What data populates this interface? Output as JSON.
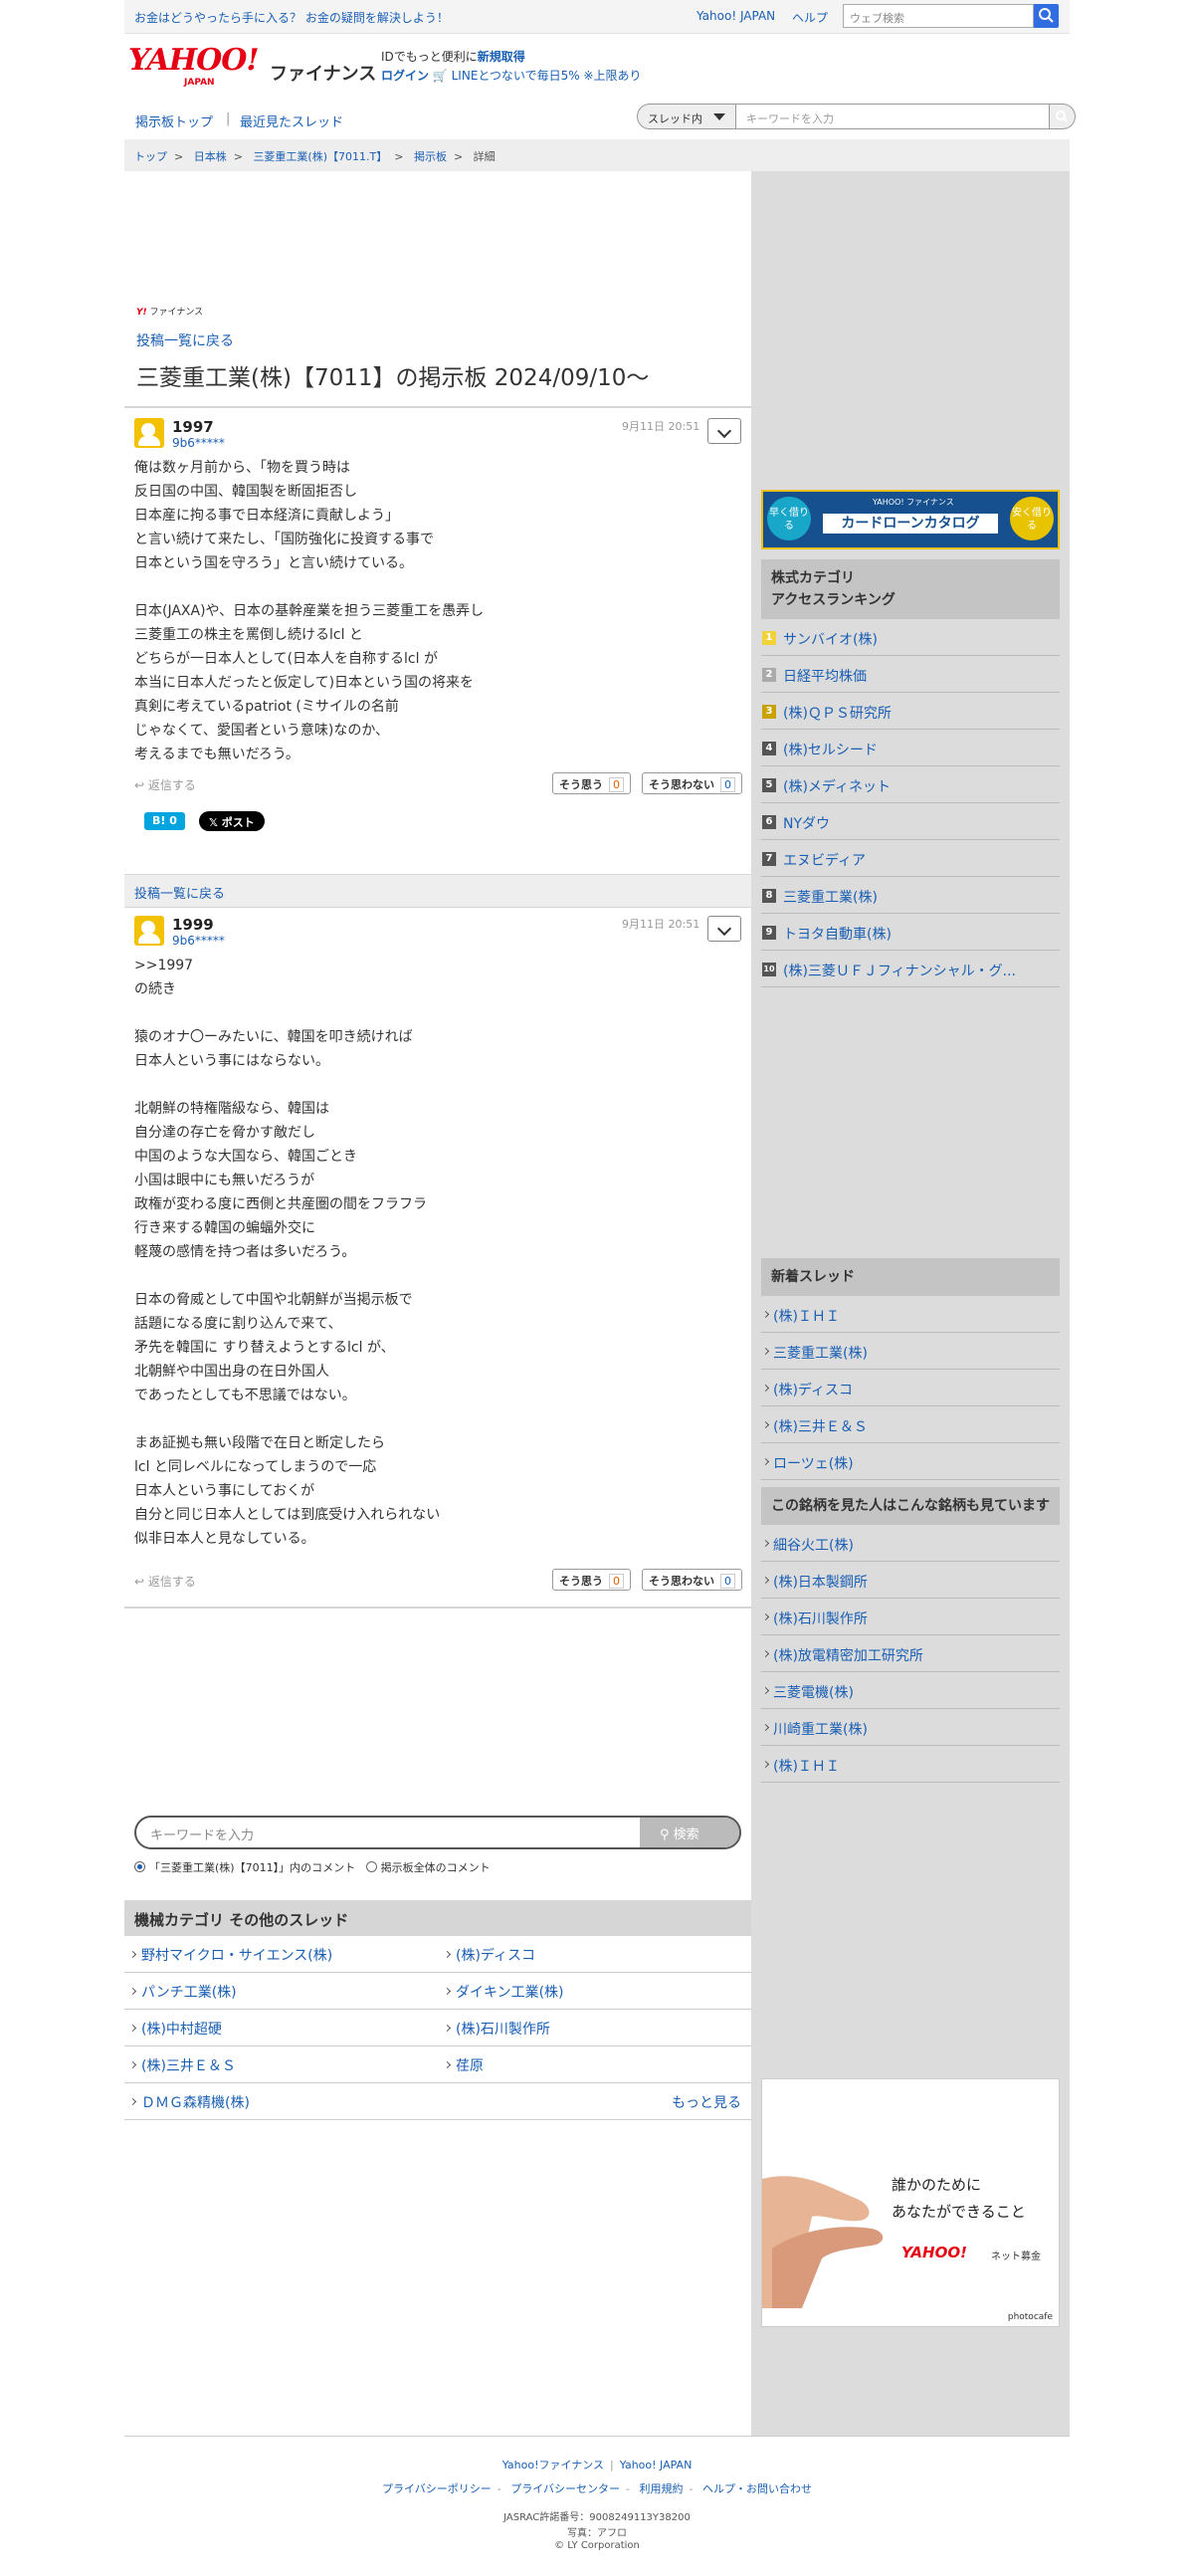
{
  "topbar": {
    "promo": "お金はどうやったら手に入る？ お金の疑問を解決しよう！",
    "yahoo_japan": "Yahoo! JAPAN",
    "help": "ヘルプ",
    "web_search_placeholder": "ウェブ検索"
  },
  "header": {
    "logo_main": "YAHOO!",
    "logo_sub": "JAPAN",
    "service": "ファイナンス",
    "line1_prefix": "IDでもっと便利に",
    "line1_link": "新規取得",
    "login": "ログイン",
    "line_promo": "LINEとつないで毎日5% ※上限あり"
  },
  "nav": {
    "board_top": "掲示板トップ",
    "recent": "最近見たスレッド",
    "scope": "スレッド内",
    "keyword_placeholder": "キーワードを入力"
  },
  "breadcrumb": [
    "トップ",
    "日本株",
    "三菱重工業(株)【7011.T】",
    "掲示板",
    "詳細"
  ],
  "thread": {
    "logo_small": "ファイナンス",
    "back": "投稿一覧に戻る",
    "title": "三菱重工業(株)【7011】の掲示板 2024/09/10〜"
  },
  "posts": [
    {
      "number": "1997",
      "user": "9b6*****",
      "date": "9月11日 20:51",
      "body": "俺は数ヶ月前から、「物を買う時は\n反日国の中国、韓国製を断固拒否し\n日本産に拘る事で日本経済に貢献しよう」\nと言い続けて来たし、「国防強化に投資する事で\n日本という国を守ろう」と言い続けている。\n\n日本(JAXA)や、日本の基幹産業を担う三菱重工を愚弄し\n三菱重工の株主を罵倒し続けるlcl と\nどちらが一日本人として(日本人を自称するlcl が\n本当に日本人だったと仮定して)日本という国の将来を\n真剣に考えているpatriot (ミサイルの名前\nじゃなくて、愛国者という意味)なのか、\n考えるまでも無いだろう。",
      "reply": "返信する",
      "agree_label": "そう思う",
      "agree": "0",
      "disagree_label": "そう思わない",
      "disagree": "0"
    },
    {
      "number": "1999",
      "user": "9b6*****",
      "date": "9月11日 20:51",
      "body": ">>1997\nの続き\n\n猿のオナ〇ーみたいに、韓国を叩き続ければ\n日本人という事にはならない。\n\n北朝鮮の特権階級なら、韓国は\n自分達の存亡を脅かす敵だし\n中国のような大国なら、韓国ごとき\n小国は眼中にも無いだろうが\n政権が変わる度に西側と共産圏の間をフラフラ\n行き来する韓国の蝙蝠外交に\n軽蔑の感情を持つ者は多いだろう。\n\n日本の脅威として中国や北朝鮮が当掲示板で\n話題になる度に割り込んで来て、\n矛先を韓国に すり替えようとするlcl が、\n北朝鮮や中国出身の在日外国人\nであったとしても不思議ではない。\n\nまあ証拠も無い段階で在日と断定したら\nlcl と同レベルになってしまうので一応\n日本人という事にしておくが\n自分と同じ日本人としては到底受け入れられない\n似非日本人と見なしている。",
      "reply": "返信する",
      "agree_label": "そう思う",
      "agree": "0",
      "disagree_label": "そう思わない",
      "disagree": "0"
    }
  ],
  "share": {
    "hatena": "B! 0",
    "x_post": "𝕏 ポスト"
  },
  "back_bar": "投稿一覧に戻る",
  "bottom_search": {
    "placeholder": "キーワードを入力",
    "button": "検索",
    "radio1": "「三菱重工業(株)【7011】」内のコメント",
    "radio2": "掲示板全体のコメント"
  },
  "other_threads": {
    "header": "機械カテゴリ  その他のスレッド",
    "rows": [
      [
        "野村マイクロ・サイエンス(株)",
        "(株)ディスコ"
      ],
      [
        "パンチ工業(株)",
        "ダイキン工業(株)"
      ],
      [
        "(株)中村超硬",
        "(株)石川製作所"
      ],
      [
        "(株)三井Ｅ＆Ｓ",
        "荏原"
      ]
    ],
    "last": "ＤＭＧ森精機(株)",
    "more": "もっと見る"
  },
  "ad_loan": {
    "left": "早く借りる",
    "right": "安く借りる",
    "brand": "YAHOO! ファイナンス",
    "main": "カードローンカタログ"
  },
  "ranking": {
    "header": "株式カテゴリ\nアクセスランキング",
    "items": [
      "サンバイオ(株)",
      "日経平均株価",
      "(株)ＱＰＳ研究所",
      "(株)セルシード",
      "(株)メディネット",
      "NYダウ",
      "エヌビディア",
      "三菱重工業(株)",
      "トヨタ自動車(株)",
      "(株)三菱ＵＦＪフィナンシャル・グ..."
    ]
  },
  "new_threads": {
    "header": "新着スレッド",
    "items": [
      "(株)ＩＨＩ",
      "三菱重工業(株)",
      "(株)ディスコ",
      "(株)三井Ｅ＆Ｓ",
      "ローツェ(株)"
    ]
  },
  "also_viewed": {
    "header": "この銘柄を見た人はこんな銘柄も見ています",
    "items": [
      "細谷火工(株)",
      "(株)日本製鋼所",
      "(株)石川製作所",
      "(株)放電精密加工研究所",
      "三菱電機(株)",
      "川崎重工業(株)",
      "(株)ＩＨＩ"
    ]
  },
  "ad_hand": {
    "line1": "誰かのために",
    "line2": "あなたができること",
    "brand": "YAHOO!",
    "brand_sub": "ネット募金",
    "photo": "photocafe"
  },
  "footer": {
    "link1": "Yahoo!ファイナンス",
    "link2": "Yahoo! JAPAN",
    "links": [
      "プライバシーポリシー",
      "プライバシーセンター",
      "利用規約",
      "ヘルプ・お問い合わせ"
    ],
    "jasrac": "JASRAC許諾番号：9008249113Y38200",
    "photo": "写真：アフロ",
    "copy": "© LY Corporation"
  }
}
